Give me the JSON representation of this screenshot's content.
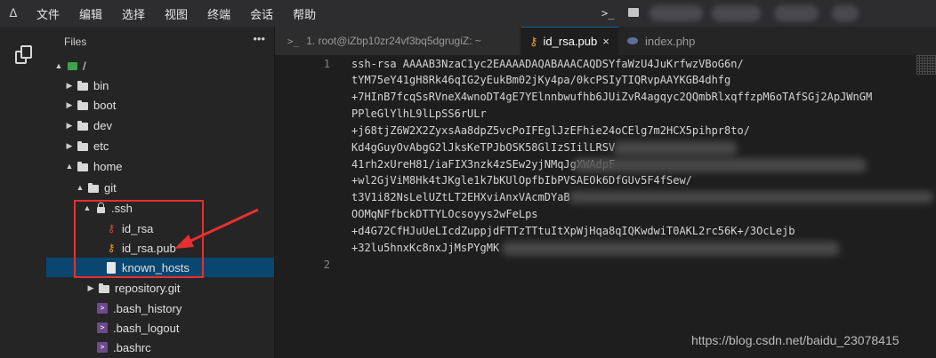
{
  "menubar": {
    "logo": "ᐃ",
    "items": [
      "文件",
      "编辑",
      "选择",
      "视图",
      "终端",
      "会话",
      "帮助"
    ],
    "terminal_glyph": ">_"
  },
  "sidebar": {
    "title": "Files",
    "more": "•••",
    "items": [
      {
        "label": "/",
        "icon": "drive-icon",
        "expanded": true
      },
      {
        "label": "bin",
        "icon": "folder-icon",
        "expanded": false
      },
      {
        "label": "boot",
        "icon": "folder-icon",
        "expanded": false
      },
      {
        "label": "dev",
        "icon": "folder-icon",
        "expanded": false
      },
      {
        "label": "etc",
        "icon": "folder-icon",
        "expanded": false
      },
      {
        "label": "home",
        "icon": "folder-icon",
        "expanded": true
      },
      {
        "label": "git",
        "icon": "folder-icon",
        "expanded": true
      },
      {
        "label": ".ssh",
        "icon": "lock-icon",
        "expanded": true
      },
      {
        "label": "id_rsa",
        "icon": "key-icon-red"
      },
      {
        "label": "id_rsa.pub",
        "icon": "key-icon-orange"
      },
      {
        "label": "known_hosts",
        "icon": "file-icon",
        "selected": true
      },
      {
        "label": "repository.git",
        "icon": "folder-icon",
        "expanded": false
      },
      {
        "label": ".bash_history",
        "icon": "terminal-icon"
      },
      {
        "label": ".bash_logout",
        "icon": "terminal-icon"
      },
      {
        "label": ".bashrc",
        "icon": "terminal-icon"
      }
    ]
  },
  "tabs": [
    {
      "label": "1. root@iZbp10zr24vf3bq5dgrugiZ: ~",
      "icon": "terminal-icon",
      "active": false
    },
    {
      "label": "id_rsa.pub",
      "icon": "key-icon",
      "active": true,
      "close": "×"
    },
    {
      "label": "index.php",
      "icon": "php-icon",
      "active": false
    }
  ],
  "editor": {
    "lines": [
      {
        "num": "1",
        "text": "ssh-rsa AAAAB3NzaC1yc2EAAAADAQABAAACAQDSYfaWzU4JuKrfwzVBoG6n/"
      },
      {
        "num": "",
        "text": "tYM75eY41gH8Rk46qIG2yEukBm02jKy4pa/0kcPSIyTIQRvpAAYKGB4dhfg"
      },
      {
        "num": "",
        "text": "+7HInB7fcqSsRVneX4wnoDT4gE7YElnnbwufhb6JUiZvR4agqyc2QQmbRlxqffzpM6oTAfSGj2ApJWnGM"
      },
      {
        "num": "",
        "text": "PPleGlYlhL9lLpSS6rULr"
      },
      {
        "num": "",
        "text": "+j68tjZ6W2X2ZyxsAa8dpZ5vcPoIFEglJzEFhie24oCElg7m2HCX5pihpr8to/"
      },
      {
        "num": "",
        "text": "Kd4gGuyOvAbgG2lJksKeTPJbOSK58GlIzSIilLRSV"
      },
      {
        "num": "",
        "text": "41rh2xUreH81/iaFIX3nzk4zSEw2yjNMqJgXWAdpF"
      },
      {
        "num": "",
        "text": "+wl2GjViM8Hk4tJKgle1k7bKUlOpfbIbPVSAEOk6DfGUv5F4fSew/"
      },
      {
        "num": "",
        "text": "t3V1i82NsLelUZtLT2EHXviAnxVAcmDYaB"
      },
      {
        "num": "",
        "text": "OOMqNFfbckDTTYLOcsoyys2wFeLps"
      },
      {
        "num": "",
        "text": "+d4G72CfHJuUeLIcdZuppjdFTTzTTtuItXpWjHqa8qIQKwdwiT0AKL2rc56K+/3OcLejb"
      },
      {
        "num": "",
        "text": "+32lu5hnxKc8nxJjMsPYgMK"
      },
      {
        "num": "2",
        "text": ""
      }
    ]
  },
  "watermark": "https://blog.csdn.net/baidu_23078415",
  "colors": {
    "accent": "#0e639c",
    "annotation": "#e5302f",
    "selection": "#094771"
  }
}
